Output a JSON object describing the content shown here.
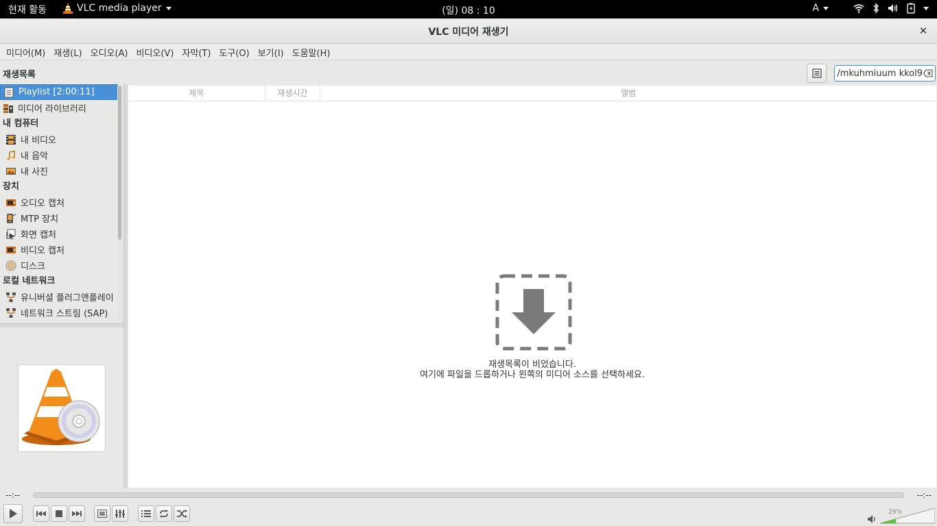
{
  "topbar": {
    "activities": "현재 활동",
    "app_name": "VLC media player",
    "clock": "(일) 08 : 10",
    "input_method": "A"
  },
  "window": {
    "title": "VLC 미디어 재생기"
  },
  "menu": [
    "미디어(M)",
    "재생(L)",
    "오디오(A)",
    "비디오(V)",
    "자막(T)",
    "도구(O)",
    "보기(I)",
    "도움말(H)"
  ],
  "sidebar": {
    "heading": "재생목록",
    "playlist": "Playlist [2:00:11]",
    "media_library": "미디어 라이브러리",
    "my_computer": {
      "label": "내 컴퓨터",
      "items": [
        {
          "label": "내 비디오",
          "icon": "film-icon"
        },
        {
          "label": "내 음악",
          "icon": "music-note-icon"
        },
        {
          "label": "내 사진",
          "icon": "picture-icon"
        }
      ]
    },
    "devices": {
      "label": "장치",
      "items": [
        {
          "label": "오디오 캡처",
          "icon": "capture-card-icon"
        },
        {
          "label": "MTP 장치",
          "icon": "mtp-device-icon"
        },
        {
          "label": "화면 캡처",
          "icon": "screen-capture-icon"
        },
        {
          "label": "비디오 캡처",
          "icon": "capture-card-icon"
        },
        {
          "label": "디스크",
          "icon": "disc-icon"
        }
      ]
    },
    "local_network": {
      "label": "로컬 네트워크",
      "items": [
        {
          "label": "유니버셜 플러그앤플레이",
          "icon": "network-icon"
        },
        {
          "label": "네트워크 스트림 (SAP)",
          "icon": "network-icon"
        }
      ]
    }
  },
  "search": {
    "value": "mkuhmiuum kkol9/"
  },
  "playlist_columns": [
    "제목",
    "재생시간",
    "앨범"
  ],
  "empty": {
    "line1": "재생목록이 비었습니다.",
    "line2": "여기에 파일을 드롭하거나 왼쪽의 미디어 소스를 선택하세요."
  },
  "seek": {
    "elapsed": "--:--",
    "remaining": "--:--"
  },
  "volume": {
    "percent_label": "29%",
    "level": 0.29
  },
  "colors": {
    "selection": "#4a90d9",
    "vlc_orange": "#e8780c"
  }
}
